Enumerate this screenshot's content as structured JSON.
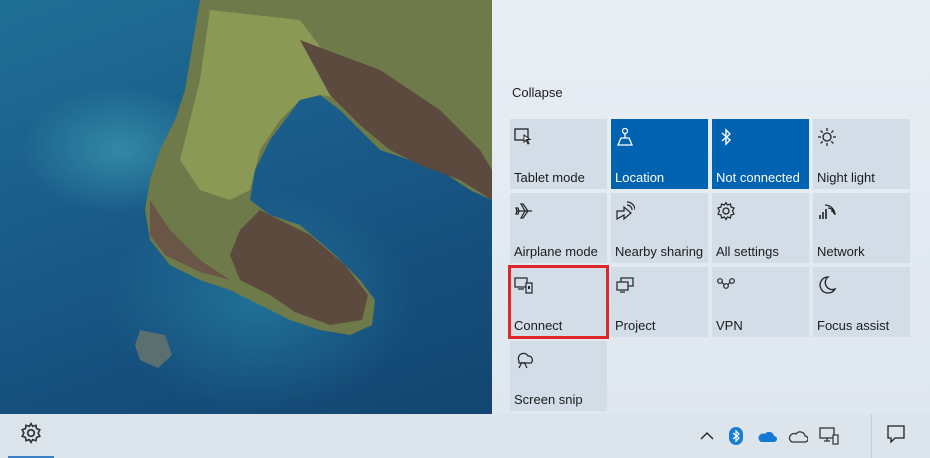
{
  "action_center": {
    "collapse_label": "Collapse",
    "accent_color": "#0063b1",
    "highlight_color": "#e0262b",
    "tiles": [
      {
        "label": "Tablet mode",
        "icon": "tablet-mode-icon",
        "active": false
      },
      {
        "label": "Location",
        "icon": "location-icon",
        "active": true
      },
      {
        "label": "Not connected",
        "icon": "bluetooth-icon",
        "active": true
      },
      {
        "label": "Night light",
        "icon": "night-light-icon",
        "active": false
      },
      {
        "label": "Airplane mode",
        "icon": "airplane-icon",
        "active": false
      },
      {
        "label": "Nearby sharing",
        "icon": "nearby-sharing-icon",
        "active": false
      },
      {
        "label": "All settings",
        "icon": "gear-icon",
        "active": false
      },
      {
        "label": "Network",
        "icon": "network-icon",
        "active": false
      },
      {
        "label": "Connect",
        "icon": "connect-icon",
        "active": false,
        "highlighted": true
      },
      {
        "label": "Project",
        "icon": "project-icon",
        "active": false
      },
      {
        "label": "VPN",
        "icon": "vpn-icon",
        "active": false
      },
      {
        "label": "Focus assist",
        "icon": "moon-icon",
        "active": false
      },
      {
        "label": "Screen snip",
        "icon": "screen-snip-icon",
        "active": false
      }
    ]
  },
  "taskbar": {
    "settings_icon": "gear-icon",
    "tray_icons": [
      "chevron-up-icon",
      "bluetooth-icon",
      "onedrive-icon",
      "onedrive-personal-icon",
      "network-icon"
    ],
    "notifications_icon": "action-center-icon"
  }
}
